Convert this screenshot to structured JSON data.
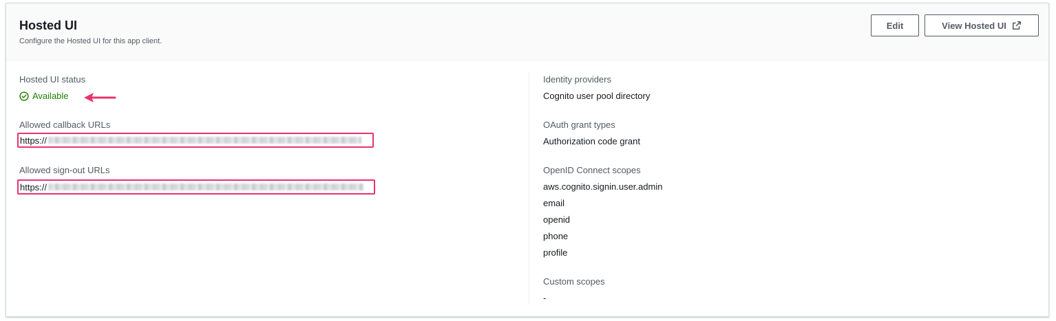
{
  "header": {
    "title": "Hosted UI",
    "description": "Configure the Hosted UI for this app client.",
    "edit_label": "Edit",
    "view_label": "View Hosted UI",
    "view_icon": "external-link-icon"
  },
  "left": {
    "status_label": "Hosted UI status",
    "status_value": "Available",
    "status_icon": "check-circle-icon",
    "status_color": "#1d8102",
    "callback_label": "Allowed callback URLs",
    "callback_prefix": "https://",
    "signout_label": "Allowed sign-out URLs",
    "signout_prefix": "https://"
  },
  "right": {
    "idp_label": "Identity providers",
    "idp_value": "Cognito user pool directory",
    "grant_label": "OAuth grant types",
    "grant_value": "Authorization code grant",
    "scopes_label": "OpenID Connect scopes",
    "scopes": [
      "aws.cognito.signin.user.admin",
      "email",
      "openid",
      "phone",
      "profile"
    ],
    "custom_label": "Custom scopes",
    "custom_value": "-"
  },
  "annotation": {
    "highlight_color": "#e8336d"
  }
}
